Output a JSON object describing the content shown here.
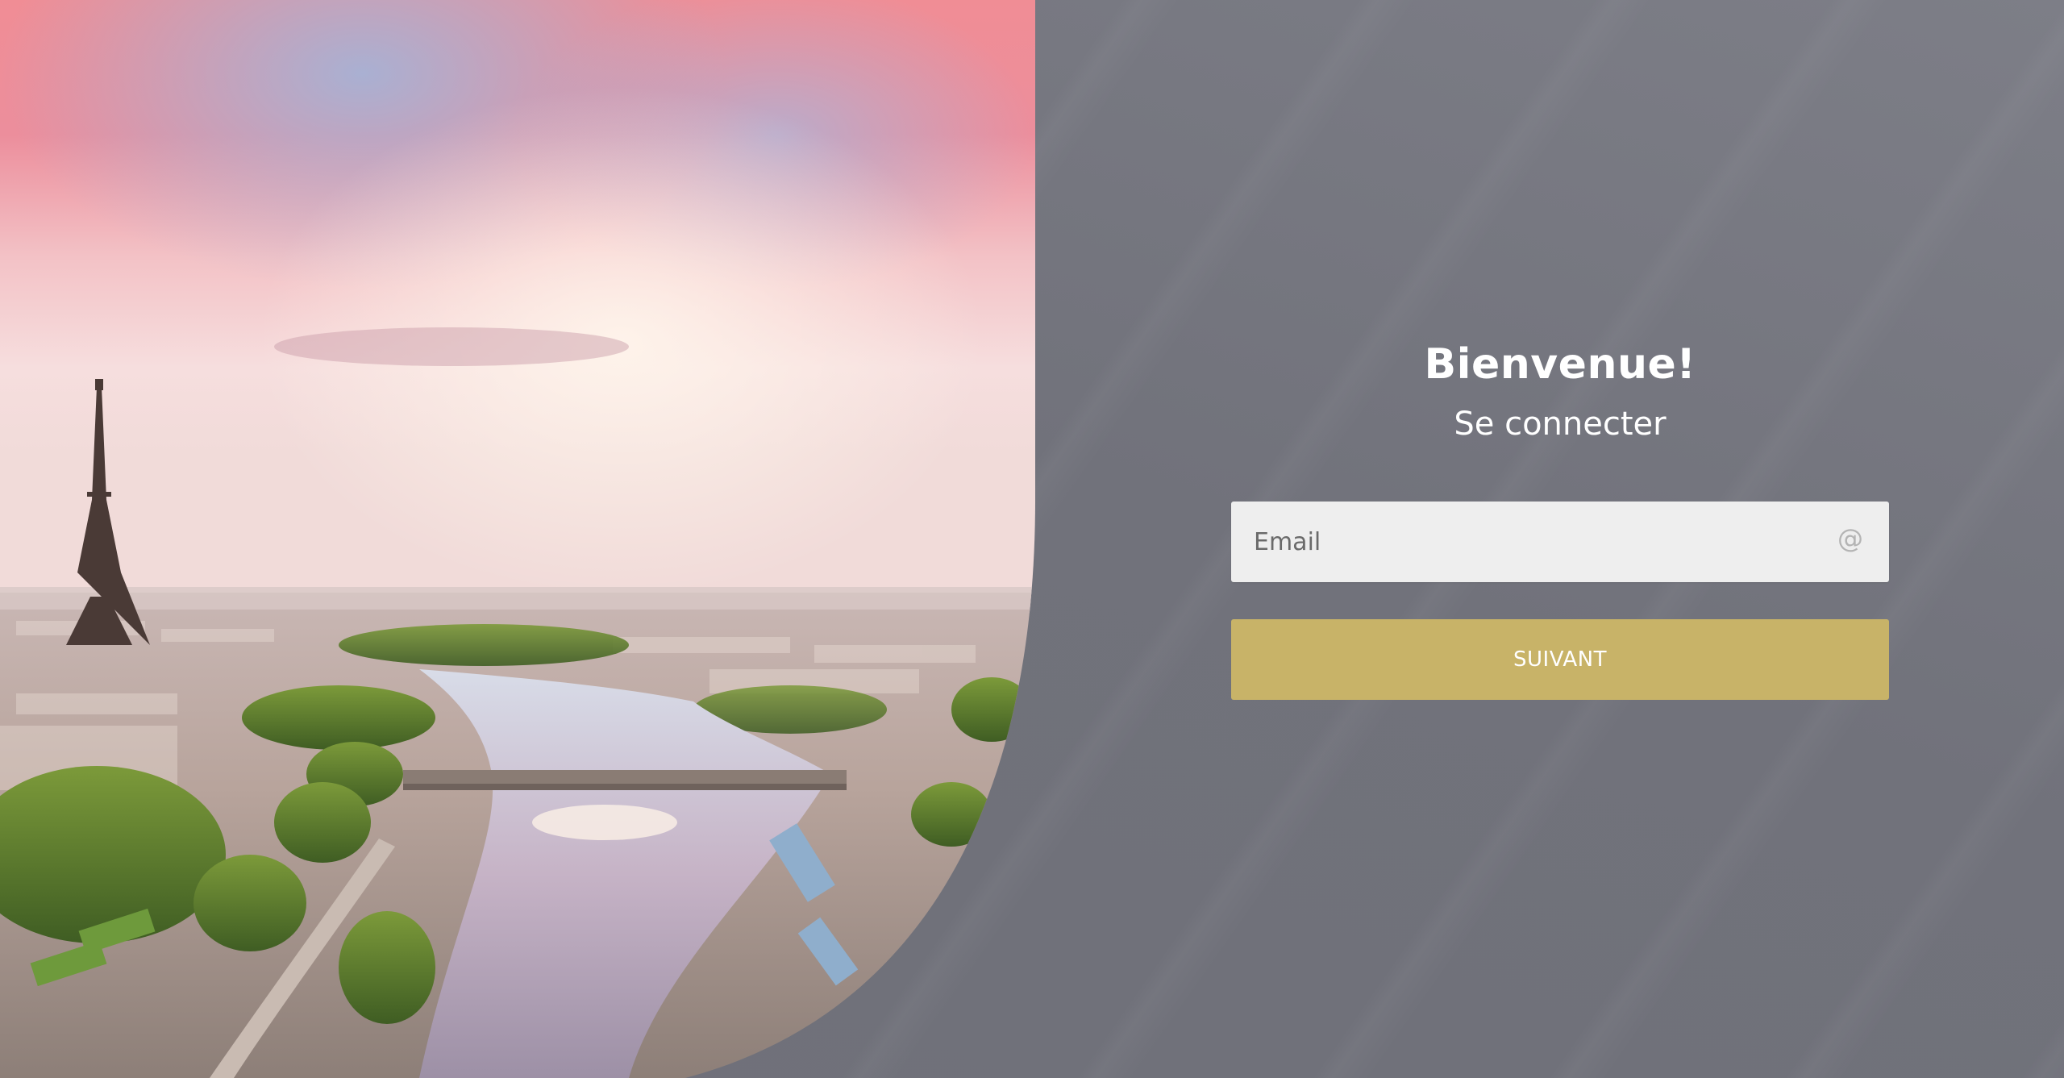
{
  "hero": {
    "image_alt": "Aerial view of Paris at sunset with the Eiffel Tower and the Seine"
  },
  "login": {
    "title": "Bienvenue!",
    "subtitle": "Se connecter",
    "email_placeholder": "Email",
    "email_value": "",
    "next_label": "SUIVANT"
  },
  "icons": {
    "email_field_icon": "at-sign-icon"
  },
  "colors": {
    "panel_background": "#74757e",
    "button_background": "#c8b368",
    "input_background": "#eeeeee",
    "text_primary": "#ffffff"
  }
}
